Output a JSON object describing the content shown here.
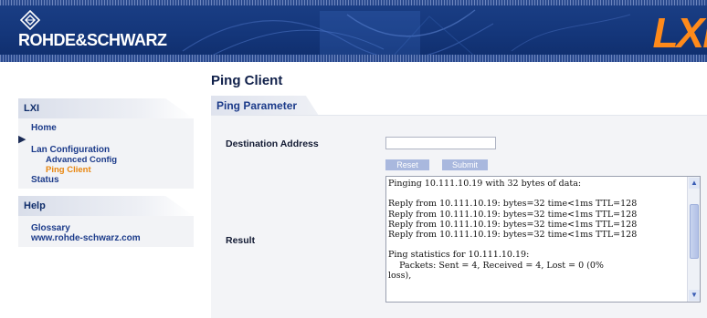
{
  "header": {
    "brand": "ROHDE&SCHWARZ",
    "lxi_logo": "LXI",
    "logo_icon": "rohde-schwarz-diamond-icon"
  },
  "sidebar": {
    "section_lxi": "LXI",
    "lxi_items": [
      {
        "label": "Home"
      },
      {
        "label": "Lan Configuration"
      },
      {
        "label": "Advanced Config"
      },
      {
        "label": "Ping Client"
      },
      {
        "label": "Status"
      }
    ],
    "section_help": "Help",
    "help_items": [
      {
        "label": "Glossary"
      },
      {
        "label": "www.rohde-schwarz.com"
      }
    ],
    "active_color": "#e8860f"
  },
  "main": {
    "title": "Ping Client",
    "tab_label": "Ping Parameter",
    "destination_label": "Destination Address",
    "destination_value": "",
    "reset_label": "Reset",
    "submit_label": "Submit",
    "result_label": "Result",
    "result_text": "Pinging 10.111.10.19 with 32 bytes of data:\n\nReply from 10.111.10.19: bytes=32 time<1ms TTL=128\nReply from 10.111.10.19: bytes=32 time<1ms TTL=128\nReply from 10.111.10.19: bytes=32 time<1ms TTL=128\nReply from 10.111.10.19: bytes=32 time<1ms TTL=128\n\nPing statistics for 10.111.10.19:\n    Packets: Sent = 4, Received = 4, Lost = 0 (0%\nloss),"
  },
  "colors": {
    "banner": "#14367a",
    "lxi_orange": "#ff8a1a",
    "link_blue": "#1c3b8a",
    "button": "#a9b8de"
  }
}
